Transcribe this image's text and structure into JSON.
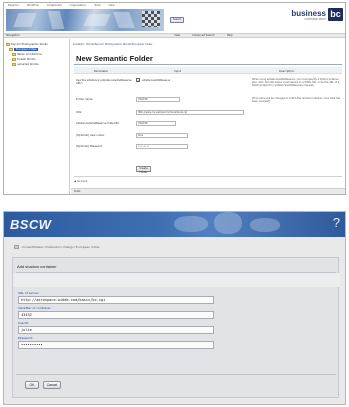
{
  "top": {
    "nav": [
      "Explorer",
      "Workflow",
      "Collaborate",
      "Organisation",
      "Tools",
      "Help"
    ],
    "search_label": "Search",
    "brand": {
      "name": "business",
      "sub": "collaborator",
      "logo": "bc"
    },
    "toolbar": {
      "left": "Navigation",
      "links": [
        "View",
        "Advanced Search",
        "Help"
      ]
    },
    "tree": [
      {
        "label": "Taycom Photographic Studio",
        "selected": false
      },
      {
        "label": "European Cities",
        "selected": true
      },
      {
        "label": "Italian Architecture",
        "selected": false
      },
      {
        "label": "Turkish Photos",
        "selected": false
      },
      {
        "label": "uploaded photos",
        "selected": false
      }
    ],
    "breadcrumb": {
      "prefix": "Location:",
      "path": "Home/Taycom Photographic Studio/European Cities"
    },
    "page_title": "New Semantic Folder",
    "form_head": {
      "parameter": "Parameter",
      "input": "Input",
      "description": "Description"
    },
    "rows": [
      {
        "label": "Use the eXistance (eXistance/eXistReserve API?)",
        "checkbox_label": "eXistance/eXistReserve",
        "description": "When using eXistance/eXistReserve, you must specify a folder/container also. Also, the URL below must resolve to a WSDL file, or be the URL of a SOAP endpoint for eXistance/eXistReserve requests."
      },
      {
        "label": "Folder name:",
        "value": "UGCL06",
        "description": "[This name will be changed to match the remote container once data has been received]"
      },
      {
        "label": "URL:",
        "value": "http://www.cnr.sample/cnr/bscw/bscw.cgi",
        "description": ""
      },
      {
        "label": "eXistance/eXistReserve folder/ID:",
        "value": "UGCL06",
        "description": ""
      },
      {
        "label": "[Optional] User name:",
        "value": "jdoe",
        "description": ""
      },
      {
        "label": "[Optional] Password:",
        "value": "••••••••",
        "description": ""
      }
    ],
    "create_button": "Create Folder",
    "back_link": "Go back",
    "bottom_bar": "Tools"
  },
  "bottom": {
    "logo": "BSCW",
    "help": "?",
    "breadcrumb": "ConsultMaster::Federation::Design::European Cities",
    "panel_title": "Add shadow container",
    "fields": [
      {
        "label": "URL of server:",
        "value": "http://aerospace.wideb.com/basic/bc.cgi"
      },
      {
        "label": "Identifier of container:",
        "value": "43432"
      },
      {
        "label": "UserID:",
        "value": "julie"
      },
      {
        "label": "Password:",
        "value": "••••••••••"
      }
    ],
    "ok_button": "OK",
    "cancel_button": "Cancel"
  },
  "colors": {
    "bscw_header": "#3f6fb3",
    "bc_brand": "#2a3c68",
    "tree_selected": "#2f5cb8",
    "field_label": "#2b44a8"
  }
}
